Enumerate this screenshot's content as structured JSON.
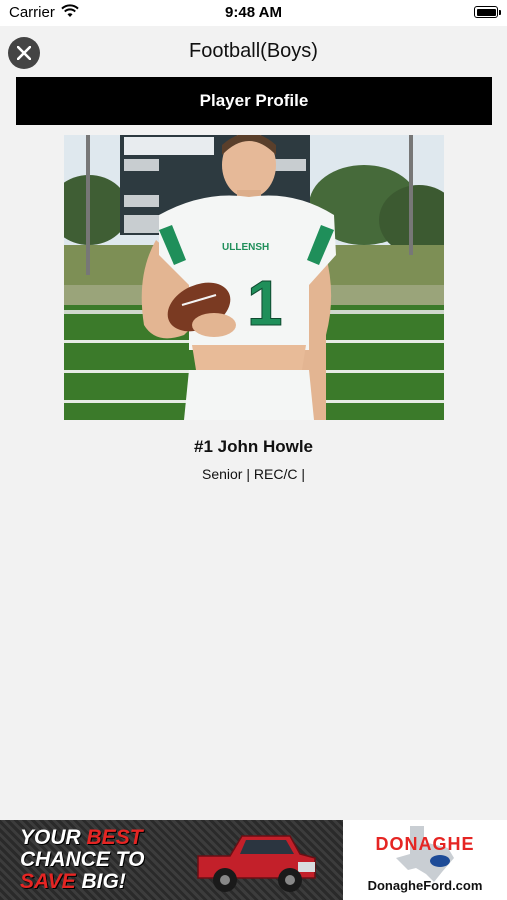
{
  "status_bar": {
    "carrier": "Carrier",
    "time": "9:48 AM"
  },
  "nav": {
    "title": "Football(Boys)"
  },
  "header": {
    "label": "Player Profile"
  },
  "player": {
    "name": "#1 John Howle",
    "details": "Senior | REC/C |",
    "jersey_number": "1"
  },
  "ad": {
    "line1_a": "YOUR ",
    "line1_b": "BEST",
    "line2": "CHANCE TO",
    "line3_a": "SAVE",
    "line3_b": " BIG!",
    "brand": "DONAGHE",
    "url": "DonagheFord.com"
  },
  "colors": {
    "header_bg": "#000000",
    "accent_red": "#e52523",
    "jersey_green": "#1f8f5a"
  }
}
